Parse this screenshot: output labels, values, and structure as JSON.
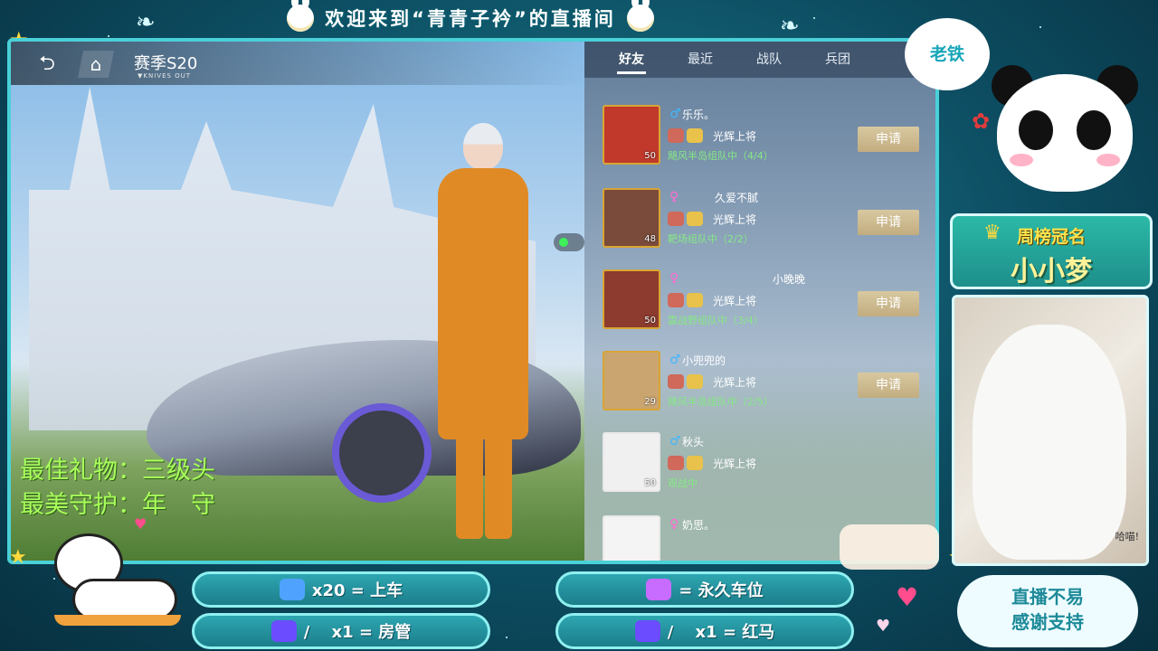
{
  "banner": {
    "title": "欢迎来到“青青子衿”的直播间"
  },
  "game": {
    "season": "赛季S20",
    "season_sub": "▼KNIVES OUT",
    "tabs": [
      "好友",
      "最近",
      "战队",
      "兵团"
    ],
    "active_tab": "好友",
    "friends": [
      {
        "gender": "♂",
        "gender_type": "male",
        "name": "乐乐。",
        "rank": "光辉上将",
        "status": "飓风半岛组队中（4/4）",
        "level": "50",
        "button": "申请",
        "avatar_color": "#c0392b"
      },
      {
        "gender": "♀",
        "gender_type": "female",
        "name": "久爱不腻",
        "rank": "光辉上将",
        "status": "靶场组队中（2/2）",
        "level": "48",
        "button": "申请",
        "avatar_color": "#7a4b3a"
      },
      {
        "gender": "♀",
        "gender_type": "female",
        "name": "小晚晚",
        "rank": "光辉上将",
        "status": "震战野组队中（3/4）",
        "level": "50",
        "button": "申请",
        "avatar_color": "#8c3b2e"
      },
      {
        "gender": "♂",
        "gender_type": "male",
        "name": "小兜兜的",
        "rank": "光辉上将",
        "status": "飓风半岛组队中（2/5）",
        "level": "29",
        "button": "申请",
        "avatar_color": "#caa570"
      },
      {
        "gender": "♂",
        "gender_type": "male",
        "name": "秋头",
        "rank": "光辉上将",
        "status": "观战中",
        "level": "50",
        "button": "",
        "avatar_color": "#f0f0f0"
      },
      {
        "gender": "♀",
        "gender_type": "female",
        "name": "奶思。",
        "rank": "",
        "status": "",
        "level": "",
        "button": "",
        "avatar_color": "#f4f4f4"
      }
    ]
  },
  "overlay": {
    "best_gift": "最佳礼物：三级头",
    "best_guard": "最美守护：年　守"
  },
  "rules": [
    {
      "text": "x20 = 上车",
      "icon": "ticket-icon",
      "color": "#4fa3ff"
    },
    {
      "text": "= 永久车位",
      "icon": "wings-icon",
      "color": "#c86bff"
    },
    {
      "text": "/ 　x1 = 房管",
      "icon": "rocket-icon",
      "color": "#6b4cff"
    },
    {
      "text": "/ 　x1 = 红马",
      "icon": "rocket-icon",
      "color": "#6b4cff"
    }
  ],
  "side": {
    "bubble": "老铁",
    "rank_title": "周榜冠名",
    "rank_name": "小小梦",
    "cam_caption": "哈喵!",
    "thanks_line1": "直播不易",
    "thanks_line2": "感谢支持"
  }
}
